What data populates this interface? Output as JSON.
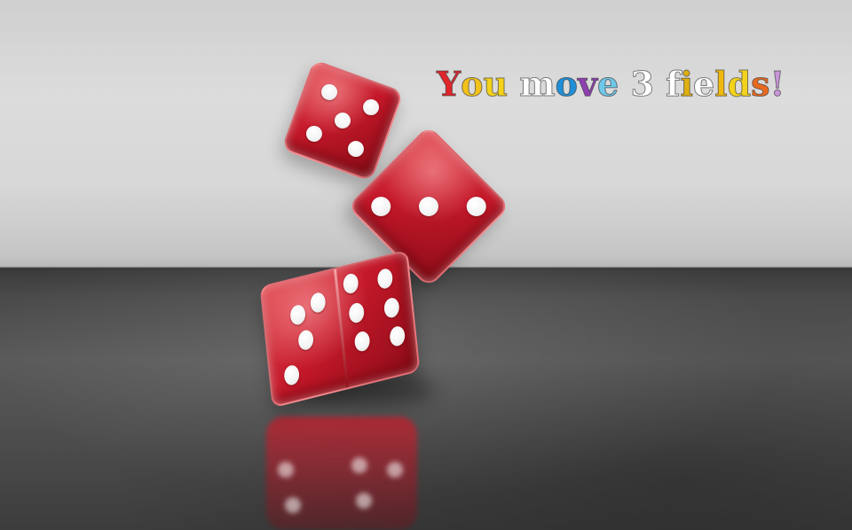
{
  "game": {
    "message": "You move 3 fields!",
    "message_colors": [
      "#e0262b",
      "#f2c21b",
      "#f4d21a",
      "#ffffff",
      "#1f8fd8",
      "#8e3fb0",
      "#6fc7e9",
      "#ffffff",
      "#ffffff",
      "#e0b012",
      "#ffffff",
      "#f0b80f",
      "#f2d21c",
      "#e86a1e",
      "#c996d9",
      "#4d5ac9",
      "#7a48b8",
      "#d21f2c"
    ]
  },
  "dice": {
    "count": 3,
    "top_die": {
      "visible_face": 5
    },
    "middle_die": {
      "visible_face": 3
    },
    "front_die": {
      "visible_faces": [
        4,
        6
      ]
    },
    "color": "#c4182a",
    "pip_color": "#ffffff"
  },
  "result": 3
}
